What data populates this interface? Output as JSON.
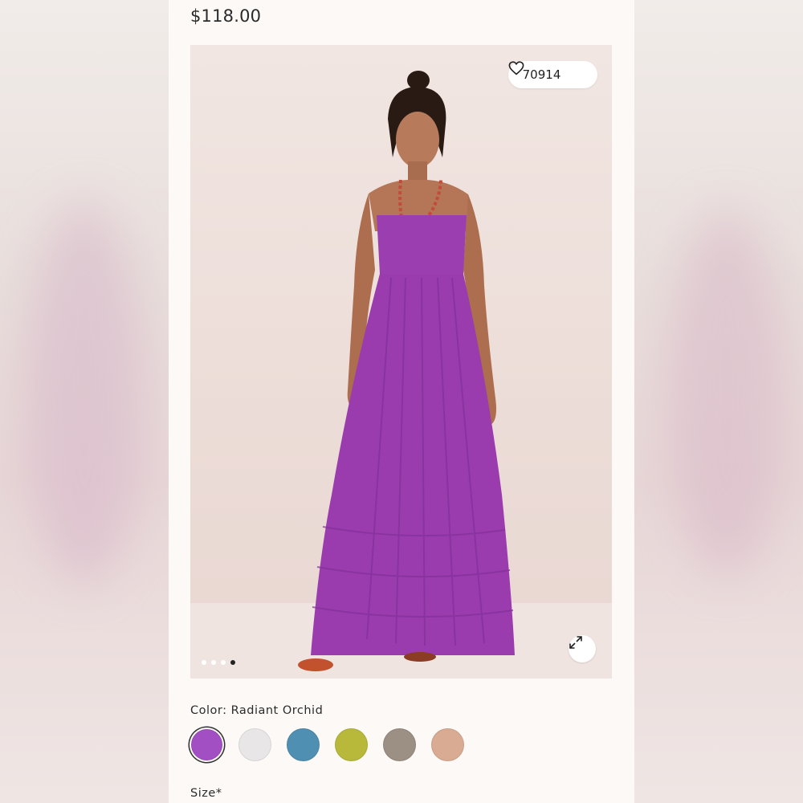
{
  "product": {
    "price": "$118.00",
    "favorites_count": "70914",
    "color_label": "Color: Radiant Orchid",
    "size_label": "Size*"
  },
  "gallery": {
    "dot_count": 4,
    "active_dot": 3
  },
  "swatches": [
    {
      "name": "Radiant Orchid",
      "color": "#a24fc4",
      "selected": true
    },
    {
      "name": "White",
      "color": "#e8e6e6",
      "selected": false
    },
    {
      "name": "Blue",
      "color": "#4f8fb2",
      "selected": false
    },
    {
      "name": "Lime",
      "color": "#b8b83a",
      "selected": false
    },
    {
      "name": "Taupe",
      "color": "#9c8f84",
      "selected": false
    },
    {
      "name": "Peach",
      "color": "#d9ab92",
      "selected": false
    }
  ],
  "icons": {
    "favorite": "heart-icon",
    "expand": "expand-icon"
  },
  "colors": {
    "dress": "#9b3fb0",
    "background": "#fcf9f7"
  }
}
